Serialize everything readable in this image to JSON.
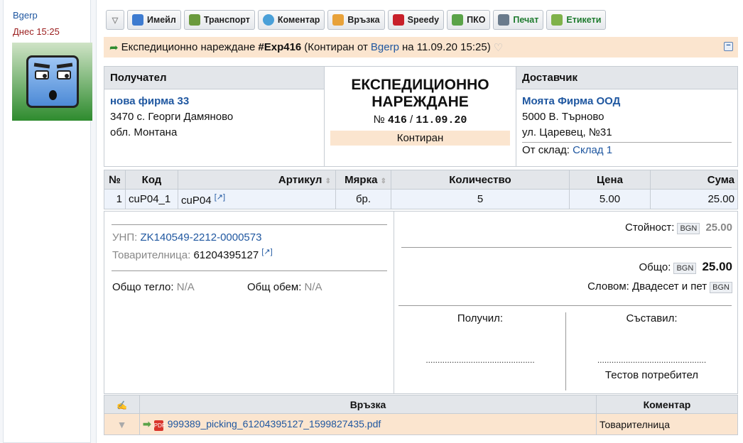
{
  "post": {
    "author": "Bgerp",
    "time": "Днес 15:25"
  },
  "toolbar": [
    {
      "label": "Имейл",
      "icon": "email-icon",
      "color": "#3d7bd0"
    },
    {
      "label": "Транспорт",
      "icon": "truck-icon",
      "color": "#6b9a3d"
    },
    {
      "label": "Коментар",
      "icon": "comment-icon",
      "color": "#4aa0d8"
    },
    {
      "label": "Връзка",
      "icon": "link-icon",
      "color": "#e8a23a"
    },
    {
      "label": "Speedy",
      "icon": "speedy-icon",
      "color": "#c8202a"
    },
    {
      "label": "ПКО",
      "icon": "cash-icon",
      "color": "#5aa348"
    },
    {
      "label": "Печат",
      "icon": "print-icon",
      "color": "#6a7b8c"
    },
    {
      "label": "Етикети",
      "icon": "label-icon",
      "color": "#7fb24a"
    }
  ],
  "doc_title": {
    "prefix": "Експедиционно нареждане",
    "number": "#Exp416",
    "state_prefix": "(Контиран от",
    "user": "Bgerp",
    "date": "на 11.09.20 15:25)"
  },
  "recipient": {
    "heading": "Получател",
    "company": "нова фирма 33",
    "line1": "3470 с. Георги Дамяново",
    "line2": "обл. Монтана"
  },
  "document": {
    "title_line1": "ЕКСПЕДИЦИОННО",
    "title_line2": "НАРЕЖДАНЕ",
    "no_sign": "№",
    "number": "416",
    "sep": "/",
    "date": "11.09.20",
    "status": "Контиран"
  },
  "supplier": {
    "heading": "Доставчик",
    "company": "Моята Фирма ООД",
    "line1": "5000 В. Търново",
    "line2": "ул. Царевец, №31",
    "store_label": "От склад:",
    "store": "Склад 1"
  },
  "items_table": {
    "headers": {
      "num": "№",
      "code": "Код",
      "article": "Артикул",
      "unit": "Мярка",
      "qty": "Количество",
      "price": "Цена",
      "sum": "Сума"
    },
    "rows": [
      {
        "num": "1",
        "code": "cuP04_1",
        "article": "cuP04",
        "link": "[↗]",
        "unit": "бр.",
        "qty": "5",
        "price": "5.00",
        "sum": "25.00"
      }
    ]
  },
  "details": {
    "unp_label": "УНП:",
    "unp": "ZK140549-2212-0000573",
    "waybill_label": "Товарителница:",
    "waybill": "61204395127",
    "waybill_link": "[↗]",
    "weight_label": "Общо тегло:",
    "weight": "N/A",
    "volume_label": "Общ обем:",
    "volume": "N/A"
  },
  "totals": {
    "value_label": "Стойност:",
    "currency": "BGN",
    "value": "25.00",
    "total_label": "Общо:",
    "total": "25.00",
    "words_label": "Словом:",
    "words": "Двадесет и пет"
  },
  "signatures": {
    "received": "Получил:",
    "compiled": "Съставил:",
    "dots": "..............................................",
    "compiled_by": "Тестов потребител"
  },
  "links_table": {
    "col_link": "Връзка",
    "col_comment": "Коментар",
    "rows": [
      {
        "file": "999389_picking_61204395127_1599827435.pdf",
        "comment": "Товарителница"
      }
    ]
  }
}
